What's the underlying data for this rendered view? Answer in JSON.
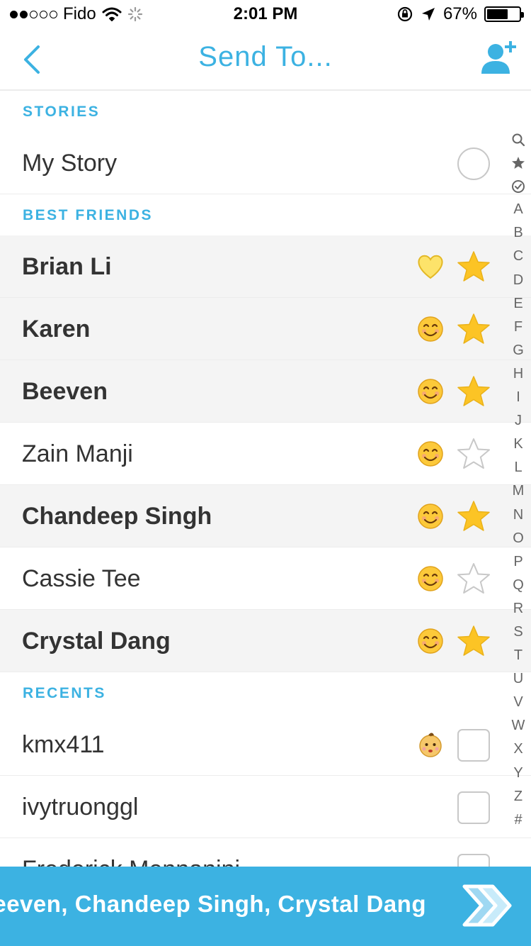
{
  "status_bar": {
    "carrier": "Fido",
    "time": "2:01 PM",
    "battery": "67%",
    "battery_level": 0.67,
    "signal_bars_filled": 2,
    "signal_bars_total": 5
  },
  "nav": {
    "title": "Send To...",
    "back_icon": "chevron-left-icon",
    "add_friend_icon": "add-friend-icon"
  },
  "colors": {
    "accent": "#3cb2e2",
    "selected_row": "#f4f4f4",
    "star": "#fcc425"
  },
  "sections": {
    "stories": {
      "header": "STORIES",
      "items": [
        {
          "name": "My Story",
          "control": "circle",
          "selected": false
        }
      ]
    },
    "best_friends": {
      "header": "BEST FRIENDS",
      "items": [
        {
          "name": "Brian Li",
          "emoji": "yellow-heart",
          "control": "star",
          "selected": true
        },
        {
          "name": "Karen",
          "emoji": "smiling-face",
          "control": "star",
          "selected": true
        },
        {
          "name": "Beeven",
          "emoji": "smiling-face",
          "control": "star",
          "selected": true
        },
        {
          "name": "Zain Manji",
          "emoji": "smiling-face",
          "control": "star",
          "selected": false
        },
        {
          "name": "Chandeep Singh",
          "emoji": "smiling-face",
          "control": "star",
          "selected": true
        },
        {
          "name": "Cassie Tee",
          "emoji": "smiling-face",
          "control": "star",
          "selected": false
        },
        {
          "name": "Crystal Dang",
          "emoji": "smiling-face",
          "control": "star",
          "selected": true
        }
      ]
    },
    "recents": {
      "header": "RECENTS",
      "items": [
        {
          "name": "kmx411",
          "emoji": "baby-face",
          "control": "checkbox",
          "selected": false
        },
        {
          "name": "ivytruonggl",
          "control": "checkbox",
          "selected": false
        },
        {
          "name": "Frederick Mennanini",
          "control": "checkbox",
          "selected": false
        }
      ]
    }
  },
  "index": [
    "search-icon",
    "star-icon",
    "check-circle-icon",
    "A",
    "B",
    "C",
    "D",
    "E",
    "F",
    "G",
    "H",
    "I",
    "J",
    "K",
    "L",
    "M",
    "N",
    "O",
    "P",
    "Q",
    "R",
    "S",
    "T",
    "U",
    "V",
    "W",
    "X",
    "Y",
    "Z",
    "#"
  ],
  "send_bar": {
    "recipients": "Brian Li, Karen, Beeven, Chandeep Singh, Crystal Dang",
    "send_icon": "double-chevron-right-icon"
  }
}
